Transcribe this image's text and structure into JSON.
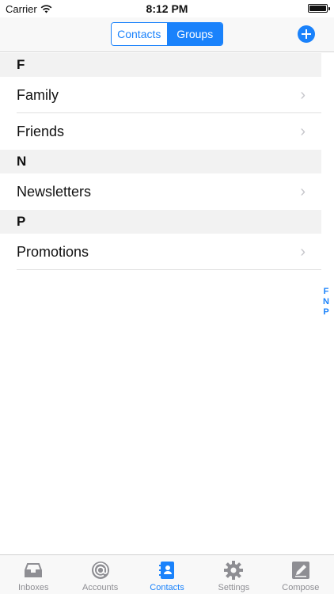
{
  "status_bar": {
    "carrier": "Carrier",
    "time": "8:12 PM"
  },
  "nav": {
    "segments": [
      {
        "label": "Contacts"
      },
      {
        "label": "Groups"
      }
    ],
    "add_icon": "plus-circle-icon",
    "accent": "#1a82fb"
  },
  "list": {
    "sections": [
      {
        "letter": "F",
        "rows": [
          "Family",
          "Friends"
        ]
      },
      {
        "letter": "N",
        "rows": [
          "Newsletters"
        ]
      },
      {
        "letter": "P",
        "rows": [
          "Promotions"
        ]
      }
    ]
  },
  "index_letters": [
    "F",
    "N",
    "P"
  ],
  "tabs": [
    {
      "label": "Inboxes",
      "icon": "inbox-icon"
    },
    {
      "label": "Accounts",
      "icon": "at-icon"
    },
    {
      "label": "Contacts",
      "icon": "contacts-book-icon"
    },
    {
      "label": "Settings",
      "icon": "gear-icon"
    },
    {
      "label": "Compose",
      "icon": "compose-icon"
    }
  ]
}
